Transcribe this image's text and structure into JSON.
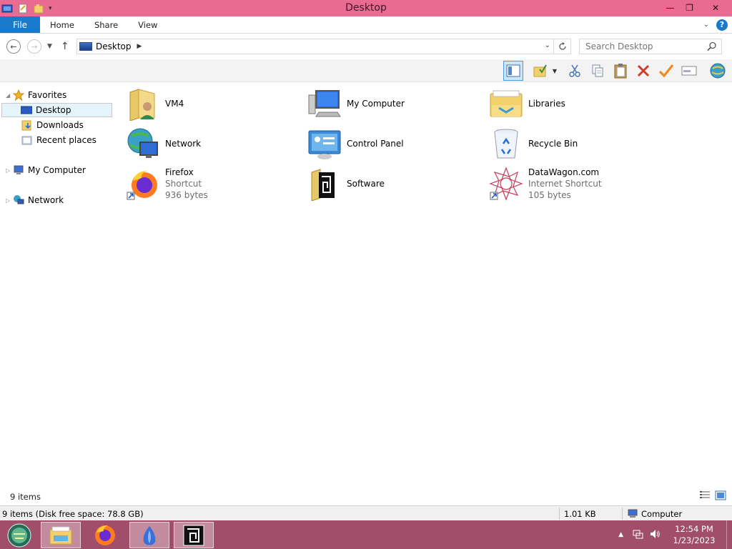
{
  "window": {
    "title": "Desktop"
  },
  "ribbon": {
    "file": "File",
    "tabs": [
      "Home",
      "Share",
      "View"
    ]
  },
  "address": {
    "location": "Desktop"
  },
  "search": {
    "placeholder": "Search Desktop"
  },
  "nav": {
    "favorites": "Favorites",
    "desktop": "Desktop",
    "downloads": "Downloads",
    "recent": "Recent places",
    "my_computer": "My Computer",
    "network": "Network"
  },
  "items": [
    {
      "name": "VM4",
      "sub1": "",
      "sub2": "",
      "icon": "user-folder-icon"
    },
    {
      "name": "My Computer",
      "sub1": "",
      "sub2": "",
      "icon": "computer-icon"
    },
    {
      "name": "Libraries",
      "sub1": "",
      "sub2": "",
      "icon": "libraries-icon"
    },
    {
      "name": "Network",
      "sub1": "",
      "sub2": "",
      "icon": "network-icon"
    },
    {
      "name": "Control Panel",
      "sub1": "",
      "sub2": "",
      "icon": "control-panel-icon"
    },
    {
      "name": "Recycle Bin",
      "sub1": "",
      "sub2": "",
      "icon": "recycle-bin-icon"
    },
    {
      "name": "Firefox",
      "sub1": "Shortcut",
      "sub2": "936 bytes",
      "icon": "firefox-icon"
    },
    {
      "name": "Software",
      "sub1": "",
      "sub2": "",
      "icon": "software-folder-icon"
    },
    {
      "name": "DataWagon.com",
      "sub1": "Internet Shortcut",
      "sub2": "105 bytes",
      "icon": "internet-shortcut-icon"
    }
  ],
  "status": {
    "count": "9 items",
    "disk": "9 items (Disk free space: 78.8 GB)",
    "size": "1.01 KB",
    "zone": "Computer"
  },
  "taskbar": {
    "time": "12:54 PM",
    "date": "1/23/2023"
  },
  "colors": {
    "titlebar": "#e96b93",
    "file_tab": "#1979ca",
    "taskbar": "#a14e6b"
  }
}
